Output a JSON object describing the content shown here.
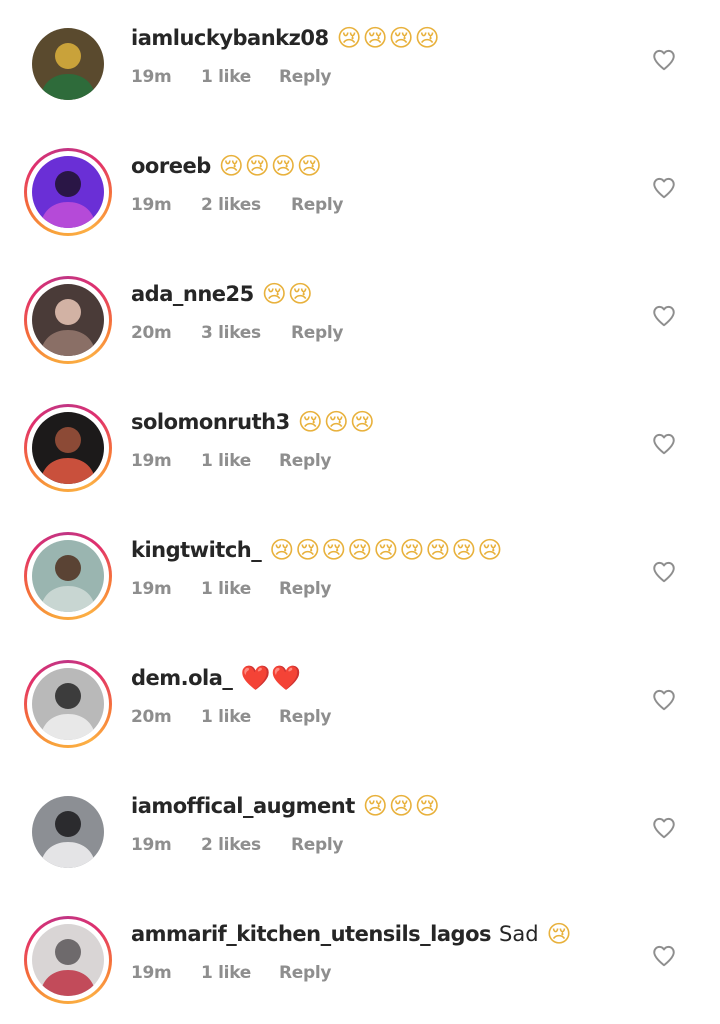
{
  "comments": [
    {
      "username": "iamluckybankz08",
      "text": "",
      "emojis": "😢😢😢😢",
      "time": "19m",
      "likes": "1 like",
      "reply": "Reply",
      "story": false,
      "avatar_colors": [
        "#5a4a2e",
        "#c9a23a",
        "#2e6b3a"
      ]
    },
    {
      "username": "ooreeb",
      "text": "",
      "emojis": "😢😢😢😢",
      "time": "19m",
      "likes": "2 likes",
      "reply": "Reply",
      "story": true,
      "avatar_colors": [
        "#6a2fd6",
        "#2a1646",
        "#b54ad8"
      ]
    },
    {
      "username": "ada_nne25",
      "text": "",
      "emojis": "😢😢",
      "time": "20m",
      "likes": "3 likes",
      "reply": "Reply",
      "story": true,
      "avatar_colors": [
        "#4a3b38",
        "#d2b2a4",
        "#8a6f66"
      ]
    },
    {
      "username": "solomonruth3",
      "text": "",
      "emojis": "😢😢😢",
      "time": "19m",
      "likes": "1 like",
      "reply": "Reply",
      "story": true,
      "avatar_colors": [
        "#1c1a1a",
        "#8c4a36",
        "#c9503c"
      ]
    },
    {
      "username": "kingtwitch_",
      "text": "",
      "emojis": "😢😢😢😢😢😢😢😢😢",
      "time": "19m",
      "likes": "1 like",
      "reply": "Reply",
      "story": true,
      "avatar_colors": [
        "#9ab5b0",
        "#5a4334",
        "#c8d6d2"
      ]
    },
    {
      "username": "dem.ola_",
      "text": "",
      "emojis": "❤️❤️",
      "hearts": true,
      "time": "20m",
      "likes": "1 like",
      "reply": "Reply",
      "story": true,
      "avatar_colors": [
        "#b9b9b9",
        "#3c3c3c",
        "#e8e8e8"
      ]
    },
    {
      "username": "iamoffical_augment",
      "text": "",
      "emojis": "😢😢😢",
      "time": "19m",
      "likes": "2 likes",
      "reply": "Reply",
      "story": false,
      "avatar_colors": [
        "#8c8f94",
        "#2b2b2e",
        "#e4e4e6"
      ]
    },
    {
      "username": "ammarif_kitchen_utensils_lagos",
      "text": "Sad",
      "emojis": "😢",
      "time": "19m",
      "likes": "1 like",
      "reply": "Reply",
      "story": true,
      "avatar_colors": [
        "#d9d5d5",
        "#6e6a6c",
        "#c24b5a"
      ]
    }
  ],
  "colors": {
    "username": "#262626",
    "meta": "#8e8e8e",
    "heart_outline": "#8e8e8e"
  },
  "icons": {
    "like": "heart-outline-icon"
  }
}
